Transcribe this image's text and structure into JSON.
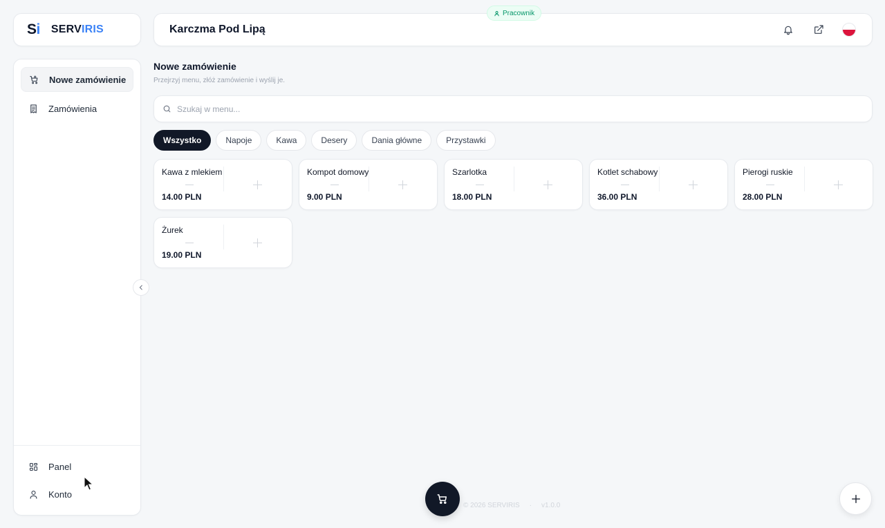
{
  "brand": {
    "mark": "S",
    "mark_accent": "i",
    "name_dark": "SERV",
    "name_accent": "IRIS",
    "accent_color": "#3b82f6"
  },
  "sidebar": {
    "items": [
      {
        "label": "Nowe zamówienie",
        "icon": "cart-plus-icon",
        "active": true
      },
      {
        "label": "Zamówienia",
        "icon": "receipt-icon",
        "active": false
      }
    ],
    "bottom_items": [
      {
        "label": "Panel",
        "icon": "dashboard-grid-icon"
      },
      {
        "label": "Konto",
        "icon": "user-icon"
      }
    ]
  },
  "header": {
    "title": "Karczma Pod Lipą",
    "role_badge": "Pracownik",
    "icons": [
      "bell-icon",
      "external-link-icon",
      "poland-flag-icon"
    ]
  },
  "main": {
    "title": "Nowe zamówienie",
    "subtitle": "Przejrzyj menu, złóż zamówienie i wyślij je.",
    "search_placeholder": "Szukaj w menu...",
    "search_value": "",
    "categories": [
      "Wszystko",
      "Napoje",
      "Kawa",
      "Desery",
      "Dania główne",
      "Przystawki"
    ],
    "active_category": "Wszystko",
    "products": [
      {
        "name": "Kawa z mlekiem",
        "price": "14.00 PLN"
      },
      {
        "name": "Kompot domowy",
        "price": "9.00 PLN"
      },
      {
        "name": "Szarlotka",
        "price": "18.00 PLN"
      },
      {
        "name": "Kotlet schabowy",
        "price": "36.00 PLN"
      },
      {
        "name": "Pierogi ruskie",
        "price": "28.00 PLN"
      },
      {
        "name": "Żurek",
        "price": "19.00 PLN"
      }
    ]
  },
  "footer": {
    "copyright": "© 2026 SERVIRIS",
    "separator": "·",
    "version": "v1.0.0"
  }
}
